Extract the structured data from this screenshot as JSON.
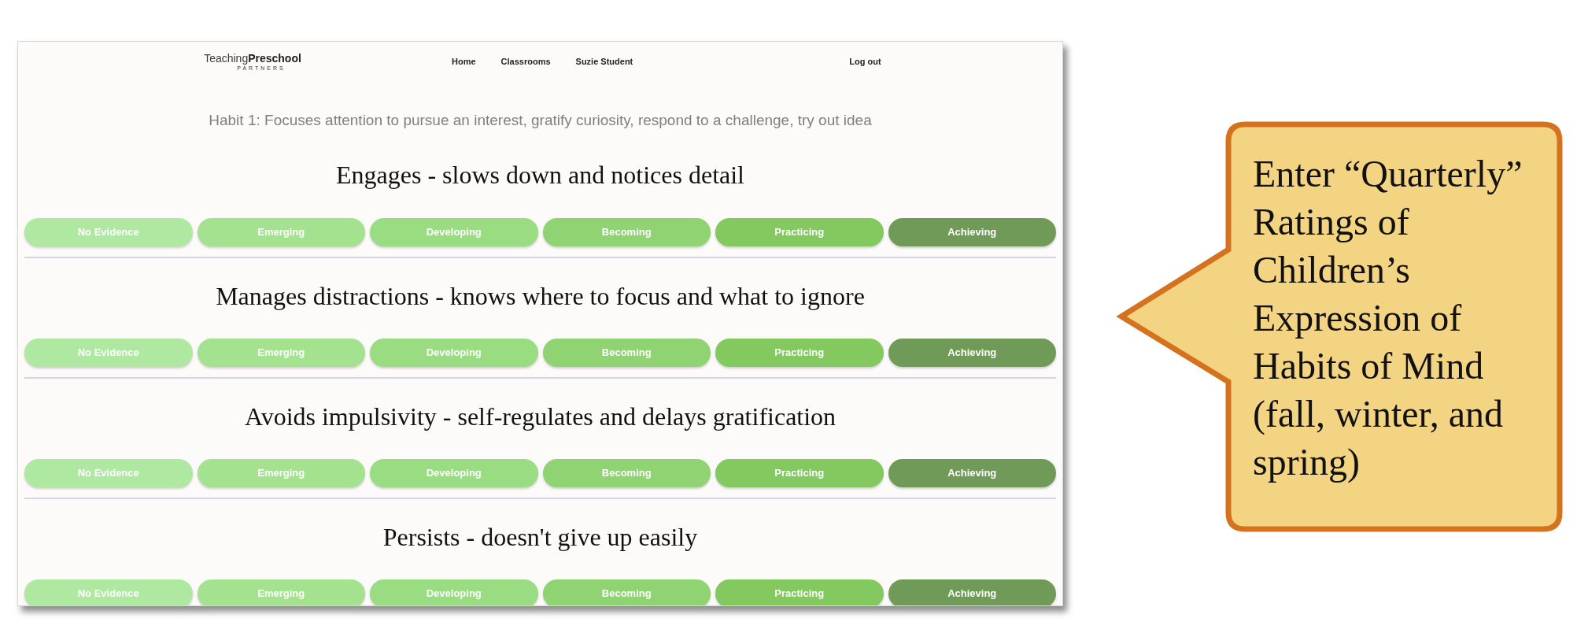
{
  "screenshot": {
    "header": {
      "logo": "Teaching**Preschool**",
      "logo_subtitle": "PARTNERS",
      "nav": [
        "Home",
        "Classrooms",
        "Suzie Student"
      ],
      "logout": "Log out"
    },
    "habit": "Habit 1: Focuses attention to pursue an interest, gratify curiosity, respond to a challenge, try out idea",
    "indicators": [
      {
        "title": "Engages - slows down and notices detail",
        "ratings": [
          {
            "label": "No Evidence",
            "color": "#afe8a0"
          },
          {
            "label": "Emerging",
            "color": "#a4e28f"
          },
          {
            "label": "Developing",
            "color": "#99dc81"
          },
          {
            "label": "Becoming",
            "color": "#8fd372"
          },
          {
            "label": "Practicing",
            "color": "#84c960"
          },
          {
            "label": "Achieving",
            "color": "#709a57"
          }
        ]
      },
      {
        "title": "Manages distractions - knows where to focus and what to ignore",
        "ratings": [
          {
            "label": "No Evidence",
            "color": "#afe8a0"
          },
          {
            "label": "Emerging",
            "color": "#a4e28f"
          },
          {
            "label": "Developing",
            "color": "#99dc81"
          },
          {
            "label": "Becoming",
            "color": "#8fd372"
          },
          {
            "label": "Practicing",
            "color": "#84c960"
          },
          {
            "label": "Achieving",
            "color": "#709a57"
          }
        ]
      },
      {
        "title": "Avoids impulsivity - self-regulates and delays gratification",
        "ratings": [
          {
            "label": "No Evidence",
            "color": "#afe8a0"
          },
          {
            "label": "Emerging",
            "color": "#a4e28f"
          },
          {
            "label": "Developing",
            "color": "#99dc81"
          },
          {
            "label": "Becoming",
            "color": "#8fd372"
          },
          {
            "label": "Practicing",
            "color": "#84c960"
          },
          {
            "label": "Achieving",
            "color": "#709a57"
          }
        ]
      },
      {
        "title": "Persists - doesn't give up easily",
        "ratings": [
          {
            "label": "No Evidence",
            "color": "#afe8a0"
          },
          {
            "label": "Emerging",
            "color": "#a4e28f"
          },
          {
            "label": "Developing",
            "color": "#99dc81"
          },
          {
            "label": "Becoming",
            "color": "#8fd372"
          },
          {
            "label": "Practicing",
            "color": "#84c960"
          },
          {
            "label": "Achieving",
            "color": "#709a57"
          }
        ]
      }
    ]
  },
  "callout": {
    "text": "Enter “Quarterly” Ratings of Children’s Expression of Habits of Mind (fall, winter, and spring)"
  }
}
